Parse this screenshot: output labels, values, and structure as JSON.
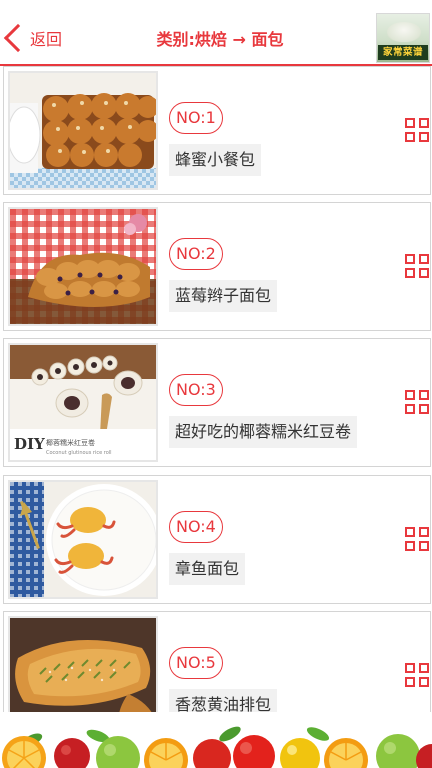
{
  "header": {
    "back_label": "返回",
    "title": "类别:烘焙 → 面包",
    "logo_text": "家常菜谱",
    "accent_color": "#e8383d"
  },
  "items": [
    {
      "no": "NO:1",
      "name": "蜂蜜小餐包",
      "thumb_caption": "蜂蜜小餐包"
    },
    {
      "no": "NO:2",
      "name": "蓝莓辫子面包"
    },
    {
      "no": "NO:3",
      "name": "超好吃的椰蓉糯米红豆卷",
      "thumb_caption": "DIY 椰蓉糯米红豆卷"
    },
    {
      "no": "NO:4",
      "name": "章鱼面包"
    },
    {
      "no": "NO:5",
      "name": "香葱黄油排包"
    }
  ],
  "icons": {
    "back": "chevron-left-icon",
    "more": "grid-icon"
  }
}
